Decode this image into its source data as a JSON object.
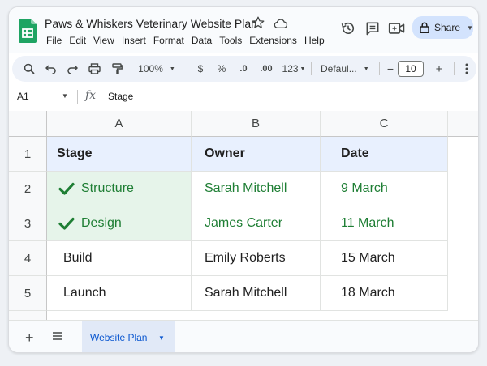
{
  "header": {
    "doc_title": "Paws & Whiskers Veterinary Website Plan",
    "menu": [
      "File",
      "Edit",
      "View",
      "Insert",
      "Format",
      "Data",
      "Tools",
      "Extensions",
      "Help"
    ],
    "share_label": "Share"
  },
  "toolbar": {
    "zoom": "100%",
    "currency": "$",
    "percent": "%",
    "dec_decrease": ".0",
    "dec_increase": ".00",
    "more_formats": "123",
    "font": "Defaul...",
    "font_size": "10",
    "minus": "−",
    "plus": "+"
  },
  "formula_bar": {
    "cell_ref": "A1",
    "fx": "fx",
    "value": "Stage"
  },
  "grid": {
    "columns": [
      "A",
      "B",
      "C"
    ],
    "row_numbers": [
      "1",
      "2",
      "3",
      "4",
      "5"
    ],
    "header": [
      "Stage",
      "Owner",
      "Date"
    ],
    "rows": [
      {
        "stage": "Structure",
        "owner": "Sarah Mitchell",
        "date": "9 March",
        "done": true
      },
      {
        "stage": "Design",
        "owner": "James Carter",
        "date": "11 March",
        "done": true
      },
      {
        "stage": "Build",
        "owner": "Emily Roberts",
        "date": "15 March",
        "done": false
      },
      {
        "stage": "Launch",
        "owner": "Sarah Mitchell",
        "date": "18 March",
        "done": false
      }
    ]
  },
  "sheets": {
    "add": "+",
    "active_tab": "Website Plan"
  },
  "colors": {
    "done_green": "#1e7e34",
    "done_fill": "#e6f4ea",
    "header_fill": "#e8f0fe",
    "accent_blue": "#0b57d0"
  },
  "icons": [
    "sheets-logo",
    "star-icon",
    "cloud-icon",
    "history-icon",
    "comment-icon",
    "meet-icon",
    "lock-icon",
    "search-icon",
    "undo-icon",
    "redo-icon",
    "print-icon",
    "paint-format-icon",
    "more-vert-icon",
    "check-icon",
    "all-sheets-icon"
  ]
}
